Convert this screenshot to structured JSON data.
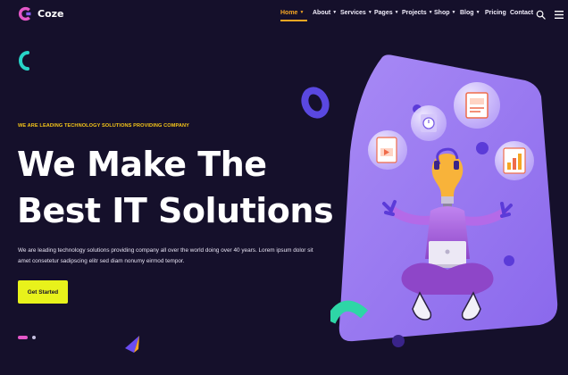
{
  "brand": {
    "name": "Coze"
  },
  "nav": {
    "items": [
      {
        "label": "Home",
        "caret": true,
        "active": true
      },
      {
        "label": "About",
        "caret": true,
        "active": false
      },
      {
        "label": "Services",
        "caret": true,
        "active": false
      },
      {
        "label": "Pages",
        "caret": true,
        "active": false
      },
      {
        "label": "Projects",
        "caret": true,
        "active": false
      },
      {
        "label": "Shop",
        "caret": true,
        "active": false
      },
      {
        "label": "Blog",
        "caret": true,
        "active": false
      },
      {
        "label": "Pricing",
        "caret": false,
        "active": false
      },
      {
        "label": "Contact",
        "caret": false,
        "active": false
      }
    ],
    "icons": [
      "search-icon",
      "menu-icon"
    ]
  },
  "hero": {
    "eyebrow": "WE ARE LEADING TECHNOLOGY SOLUTIONS PROVIDING COMPANY",
    "headline_line1": "We Make The",
    "headline_line2": "Best IT Solutions",
    "description": "We are leading technology solutions providing company all over the world doing over 40 years. Lorem ipsum dolor sit amet consetetur sadipscing elitr sed diam nonumy eirmod tempor.",
    "cta_label": "Get Started"
  },
  "slider": {
    "slides": 2,
    "active": 1
  },
  "colors": {
    "background": "#15102b",
    "accent_yellow": "#e8f21b",
    "accent_orange": "#f5a623",
    "accent_pink": "#e457c8",
    "card_purple": "#9878f0"
  }
}
